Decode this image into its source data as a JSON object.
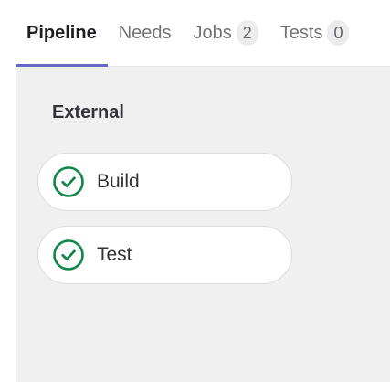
{
  "tabs": [
    {
      "label": "Pipeline",
      "active": true,
      "count": null
    },
    {
      "label": "Needs",
      "active": false,
      "count": null
    },
    {
      "label": "Jobs",
      "active": false,
      "count": "2"
    },
    {
      "label": "Tests",
      "active": false,
      "count": "0"
    }
  ],
  "stage": {
    "title": "External",
    "jobs": [
      {
        "name": "Build",
        "status": "passed",
        "icon": "check-circle-icon"
      },
      {
        "name": "Test",
        "status": "passed",
        "icon": "check-circle-icon"
      }
    ]
  },
  "colors": {
    "active_tab_underline": "#6666c4",
    "status_success": "#108548",
    "stage_background": "#f0f0f0"
  }
}
